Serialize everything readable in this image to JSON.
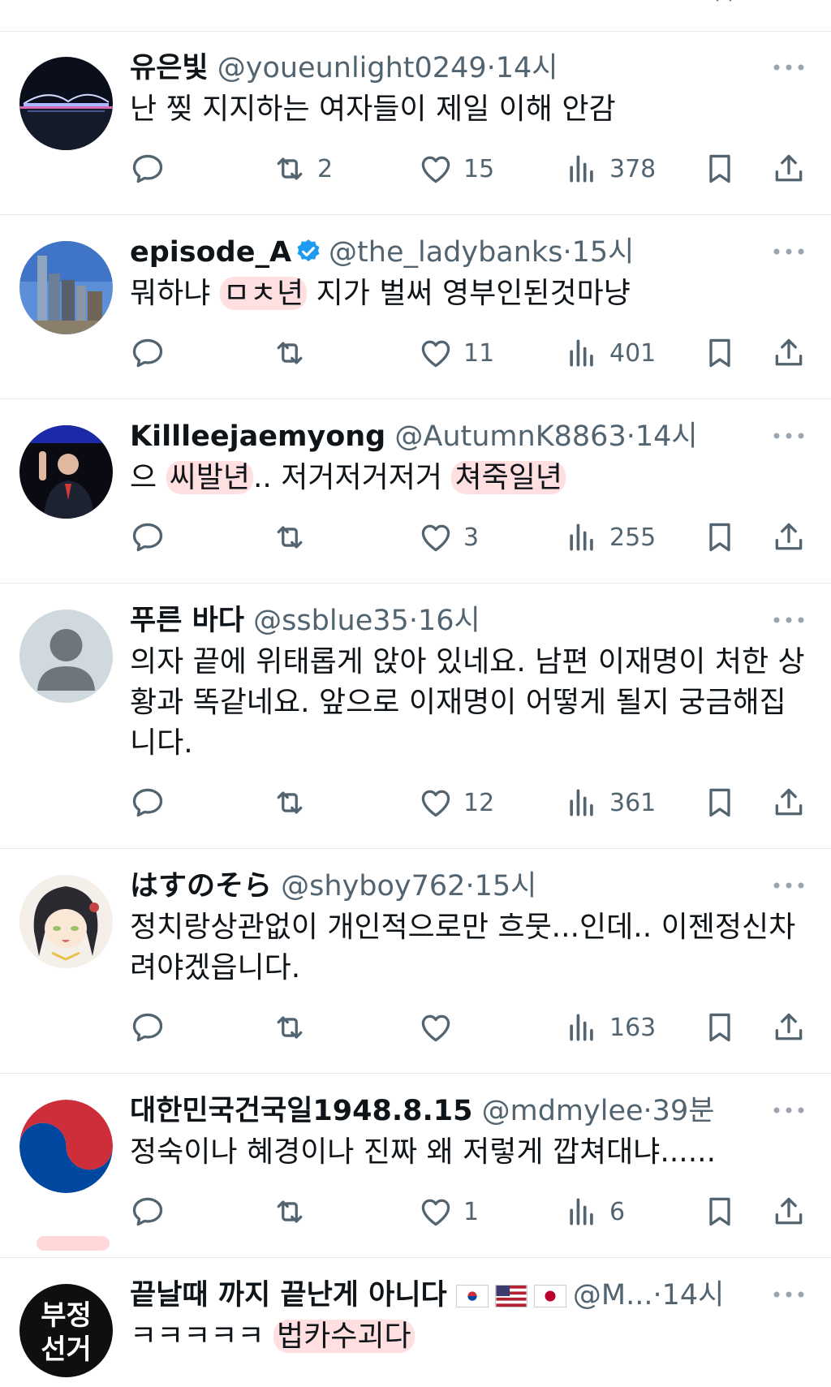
{
  "colors": {
    "text_primary": "#0f1419",
    "text_secondary": "#536471",
    "divider": "#e6e9ec",
    "verified": "#1d9bf0",
    "highlight": "#ffb9b9"
  },
  "tweets": [
    {
      "name": "유은빛",
      "handle": "@youeunlight0249",
      "dot": "·",
      "time": "14시",
      "text": "난 찢 지지하는 여자들이 제일 이해 안감",
      "replies": "",
      "retweets": "2",
      "likes": "15",
      "views": "378",
      "avatar_icon": "night-bridge-avatar"
    },
    {
      "name": "episode_A",
      "verified": true,
      "handle": "@the_ladybanks",
      "dot": "·",
      "time": "15시",
      "text_parts": [
        "뭐하냐 ",
        "ㅁㅊ년",
        " 지가 벌써 영부인된것마냥"
      ],
      "replies": "",
      "retweets": "",
      "likes": "11",
      "views": "401",
      "avatar_icon": "city-skyline-avatar"
    },
    {
      "name": "Killleejaemyong",
      "handle": "@AutumnK8863",
      "dot": "·",
      "time": "14시",
      "text_parts": [
        "으 ",
        "씨발년",
        ".. 저거저거저거 ",
        "쳐죽일년"
      ],
      "replies": "",
      "retweets": "",
      "likes": "3",
      "views": "255",
      "avatar_icon": "person-waving-avatar"
    },
    {
      "name": "푸른 바다",
      "handle": "@ssblue35",
      "dot": "·",
      "time": "16시",
      "text": "의자 끝에 위태롭게 앉아 있네요. 남편 이재명이 처한 상황과 똑같네요. 앞으로 이재명이 어떻게 될지 궁금해집니다.",
      "replies": "",
      "retweets": "",
      "likes": "12",
      "views": "361",
      "avatar_icon": "default-profile-avatar"
    },
    {
      "name": "はすのそら",
      "handle": "@shyboy762",
      "dot": "·",
      "time": "15시",
      "text": "정치랑상관없이 개인적으로만 흐뭇...인데..  이젠정신차려야겠읍니다.",
      "replies": "",
      "retweets": "",
      "likes": "",
      "views": "163",
      "avatar_icon": "anime-girl-avatar"
    },
    {
      "name": "대한민국건국일1948.8.15",
      "handle": "@mdmylee",
      "dot": "·",
      "time": "39분",
      "text": "정숙이나 혜경이나 진짜 왜 저렇게 깝쳐대냐......",
      "replies": "",
      "retweets": "",
      "likes": "1",
      "views": "6",
      "avatar_icon": "taegeuk-avatar"
    },
    {
      "name": "끝날때 까지 끝난게 아니다",
      "flags": [
        "korea-flag-icon",
        "usa-flag-icon",
        "japan-flag-icon"
      ],
      "handle": "@M...",
      "dot": "·",
      "time": "14시",
      "text_parts": [
        "ㅋㅋㅋㅋㅋ ",
        "법카수괴다"
      ],
      "avatar_text": [
        "부정",
        "선거"
      ],
      "avatar_icon": "text-badge-avatar"
    }
  ]
}
